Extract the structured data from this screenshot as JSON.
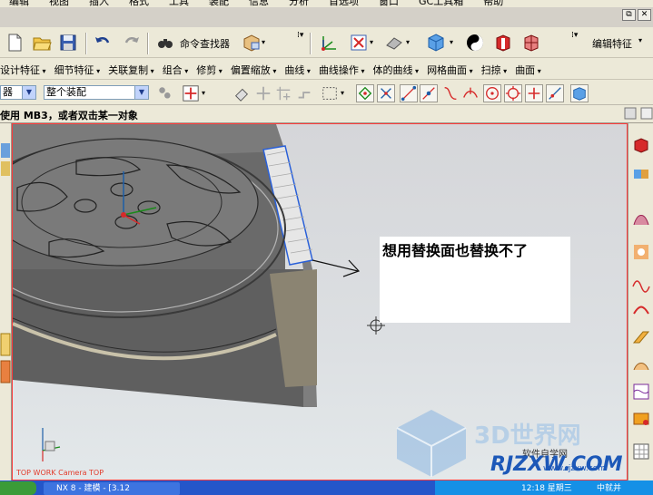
{
  "menubar": {
    "items": [
      "编辑",
      "视图",
      "插入",
      "格式",
      "工具",
      "装配",
      "信息",
      "分析",
      "首选项",
      "窗口",
      "GC工具箱",
      "帮助"
    ]
  },
  "window_buttons": [
    "⧉",
    "✕"
  ],
  "toolbar1": {
    "command_finder_label": "命令查找器",
    "edit_feature_label": "编辑特征"
  },
  "toolbar2": {
    "menus": [
      "设计特征",
      "细节特征",
      "关联复制",
      "组合",
      "修剪",
      "偏置缩放",
      "曲线",
      "曲线操作",
      "体的曲线",
      "网格曲面",
      "扫掠",
      "曲面"
    ]
  },
  "toolbar3": {
    "filter_value": "器",
    "scope_value": "整个装配"
  },
  "status_bar": {
    "prompt": "使用 MB3，或者双击某一对象"
  },
  "viewport": {
    "view_label": "TOP WORK Camera TOP",
    "annotation": "想用替换面也替换不了"
  },
  "taskbar": {
    "app_label": "NX 8 - 建模 - [3.12",
    "time": "12:18 星期三",
    "ime": "中就并"
  },
  "watermark": {
    "title": "3D世界网",
    "sub": "软件自学网",
    "logo": "RJZXW.COM",
    "url": "www.rjzxw.com"
  },
  "colors": {
    "viewport_border": "#ff3b3b",
    "toolbar_bg": "#ece9d8",
    "accent_red": "#d62a2a",
    "taskbar_blue": "#2456c9"
  }
}
